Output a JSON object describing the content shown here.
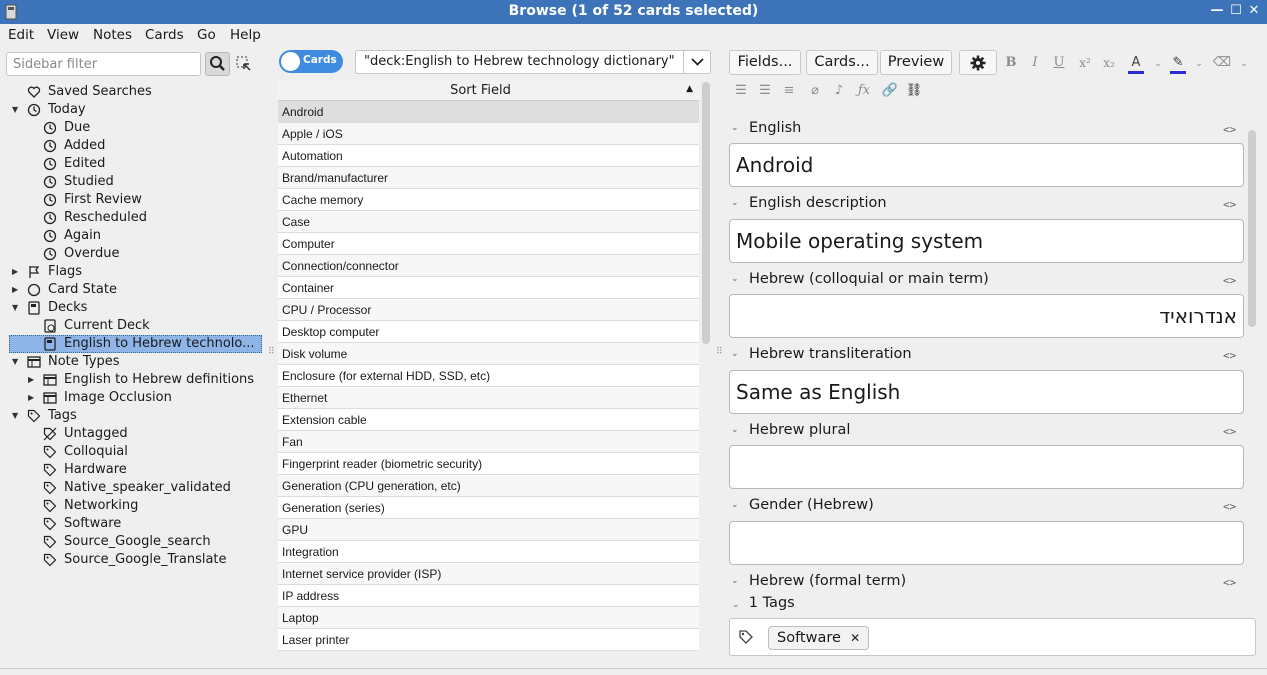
{
  "window": {
    "title": "Browse (1 of 52 cards selected)",
    "minimize": "—",
    "maximize": "☐",
    "close": "✕"
  },
  "menu": [
    "Edit",
    "View",
    "Notes",
    "Cards",
    "Go",
    "Help"
  ],
  "sidebar": {
    "filter_placeholder": "Sidebar filter",
    "items": [
      {
        "label": "Saved Searches",
        "level": 0,
        "icon": "heart-icon",
        "arrow": ""
      },
      {
        "label": "Today",
        "level": 0,
        "icon": "clock-icon",
        "arrow": "expanded"
      },
      {
        "label": "Due",
        "level": 1,
        "icon": "clock-icon",
        "arrow": ""
      },
      {
        "label": "Added",
        "level": 1,
        "icon": "clock-icon",
        "arrow": ""
      },
      {
        "label": "Edited",
        "level": 1,
        "icon": "clock-icon",
        "arrow": ""
      },
      {
        "label": "Studied",
        "level": 1,
        "icon": "clock-icon",
        "arrow": ""
      },
      {
        "label": "First Review",
        "level": 1,
        "icon": "clock-icon",
        "arrow": ""
      },
      {
        "label": "Rescheduled",
        "level": 1,
        "icon": "clock-icon",
        "arrow": ""
      },
      {
        "label": "Again",
        "level": 1,
        "icon": "clock-icon",
        "arrow": ""
      },
      {
        "label": "Overdue",
        "level": 1,
        "icon": "clock-icon",
        "arrow": ""
      },
      {
        "label": "Flags",
        "level": 0,
        "icon": "flag-icon",
        "arrow": "collapsed"
      },
      {
        "label": "Card State",
        "level": 0,
        "icon": "circle-icon",
        "arrow": "collapsed"
      },
      {
        "label": "Decks",
        "level": 0,
        "icon": "deck-icon",
        "arrow": "expanded"
      },
      {
        "label": "Current Deck",
        "level": 1,
        "icon": "current-deck-icon",
        "arrow": ""
      },
      {
        "label": "English to Hebrew technolo...",
        "level": 1,
        "icon": "deck-icon",
        "arrow": "",
        "selected": true
      },
      {
        "label": "Note Types",
        "level": 0,
        "icon": "table-icon",
        "arrow": "expanded"
      },
      {
        "label": "English to Hebrew definitions",
        "level": 1,
        "icon": "table-icon",
        "arrow": "collapsed"
      },
      {
        "label": "Image Occlusion",
        "level": 1,
        "icon": "table-icon",
        "arrow": "collapsed"
      },
      {
        "label": "Tags",
        "level": 0,
        "icon": "tag-icon",
        "arrow": "expanded"
      },
      {
        "label": "Untagged",
        "level": 1,
        "icon": "untagged-icon",
        "arrow": ""
      },
      {
        "label": "Colloquial",
        "level": 1,
        "icon": "tag-icon",
        "arrow": ""
      },
      {
        "label": "Hardware",
        "level": 1,
        "icon": "tag-icon",
        "arrow": ""
      },
      {
        "label": "Native_speaker_validated",
        "level": 1,
        "icon": "tag-icon",
        "arrow": ""
      },
      {
        "label": "Networking",
        "level": 1,
        "icon": "tag-icon",
        "arrow": ""
      },
      {
        "label": "Software",
        "level": 1,
        "icon": "tag-icon",
        "arrow": ""
      },
      {
        "label": "Source_Google_search",
        "level": 1,
        "icon": "tag-icon",
        "arrow": ""
      },
      {
        "label": "Source_Google_Translate",
        "level": 1,
        "icon": "tag-icon",
        "arrow": ""
      }
    ]
  },
  "browser": {
    "toggle_label": "Cards",
    "search_value": "\"deck:English to Hebrew technology dictionary\"",
    "column_header": "Sort Field",
    "rows": [
      "Android",
      "Apple / iOS",
      "Automation",
      "Brand/manufacturer",
      "Cache memory",
      "Case",
      "Computer",
      "Connection/connector",
      "Container",
      "CPU / Processor",
      "Desktop computer",
      "Disk volume",
      "Enclosure (for external HDD, SSD, etc)",
      "Ethernet",
      "Extension cable",
      "Fan",
      "Fingerprint reader (biometric security)",
      "Generation (CPU generation, etc)",
      "Generation (series)",
      "GPU",
      "Integration",
      "Internet service provider (ISP)",
      "IP address",
      "Laptop",
      "Laser printer"
    ],
    "selected_row": 0
  },
  "editor": {
    "buttons": {
      "fields": "Fields...",
      "cards": "Cards...",
      "preview": "Preview"
    },
    "fields": [
      {
        "name": "English",
        "value": "Android",
        "rtl": false
      },
      {
        "name": "English description",
        "value": "Mobile operating system",
        "rtl": false
      },
      {
        "name": "Hebrew (colloquial or main term)",
        "value": "אנדרואיד",
        "rtl": true
      },
      {
        "name": "Hebrew transliteration",
        "value": "Same as English",
        "rtl": false
      },
      {
        "name": "Hebrew plural",
        "value": "",
        "rtl": false
      },
      {
        "name": "Gender (Hebrew)",
        "value": "",
        "rtl": false
      },
      {
        "name": "Hebrew (formal term)",
        "value": "",
        "rtl": false
      }
    ],
    "code_toggle": "<>",
    "tags_header": "1 Tags",
    "tags": [
      "Software"
    ],
    "colors": {
      "text_color": "#2b2bd8",
      "highlight_color": "#2b2bd8"
    }
  }
}
